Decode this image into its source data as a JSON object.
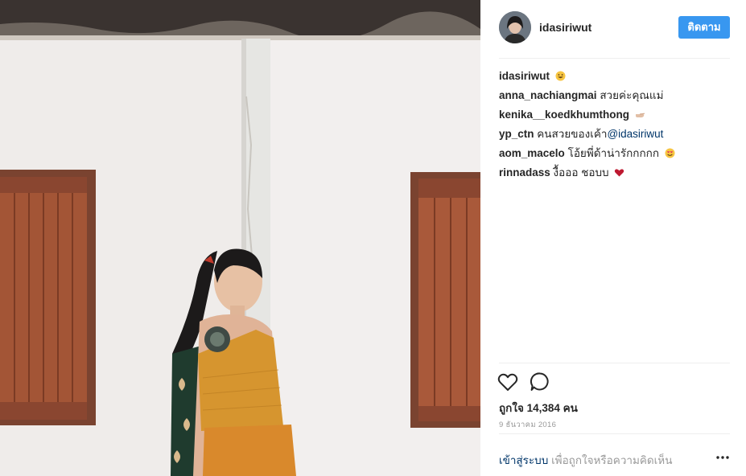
{
  "post": {
    "photo_icon": "post-photo",
    "author": {
      "username": "idasiriwut",
      "avatar_icon": "avatar-icon"
    },
    "follow_label": "ติดตาม",
    "comments": [
      {
        "user": "idasiriwut",
        "text": "",
        "mention": "",
        "emoji": "grinning-face-icon"
      },
      {
        "user": "anna_nachiangmai",
        "text": "สวยค่ะคุณแม่",
        "mention": "",
        "emoji": ""
      },
      {
        "user": "kenika__koedkhumthong",
        "text": "",
        "mention": "",
        "emoji": "pointing-hand-icon"
      },
      {
        "user": "yp_ctn",
        "text": "คนสวยของเค้า",
        "mention": "@idasiriwut",
        "emoji": ""
      },
      {
        "user": "aom_macelo",
        "text": "โอ้ยพี่ด้าน่ารักกกกก",
        "mention": "",
        "emoji": "heart-eyes-face-icon"
      },
      {
        "user": "rinnadass",
        "text": "งื้อออ ชอบบ",
        "mention": "",
        "emoji": "red-heart-icon"
      }
    ],
    "actions": {
      "like_icon": "heart-outline-icon",
      "comment_icon": "comment-bubble-icon"
    },
    "likes_text": "ถูกใจ 14,384 คน",
    "date": "9 ธันวาคม 2016",
    "login_prompt": {
      "link_label": "เข้าสู่ระบบ",
      "rest": " เพื่อถูกใจหรือความคิดเห็น"
    },
    "more_icon": "more-options-icon"
  },
  "colors": {
    "follow_button": "#3897f0",
    "link_text": "#003569",
    "muted_text": "#999999",
    "divider": "#efefef"
  }
}
